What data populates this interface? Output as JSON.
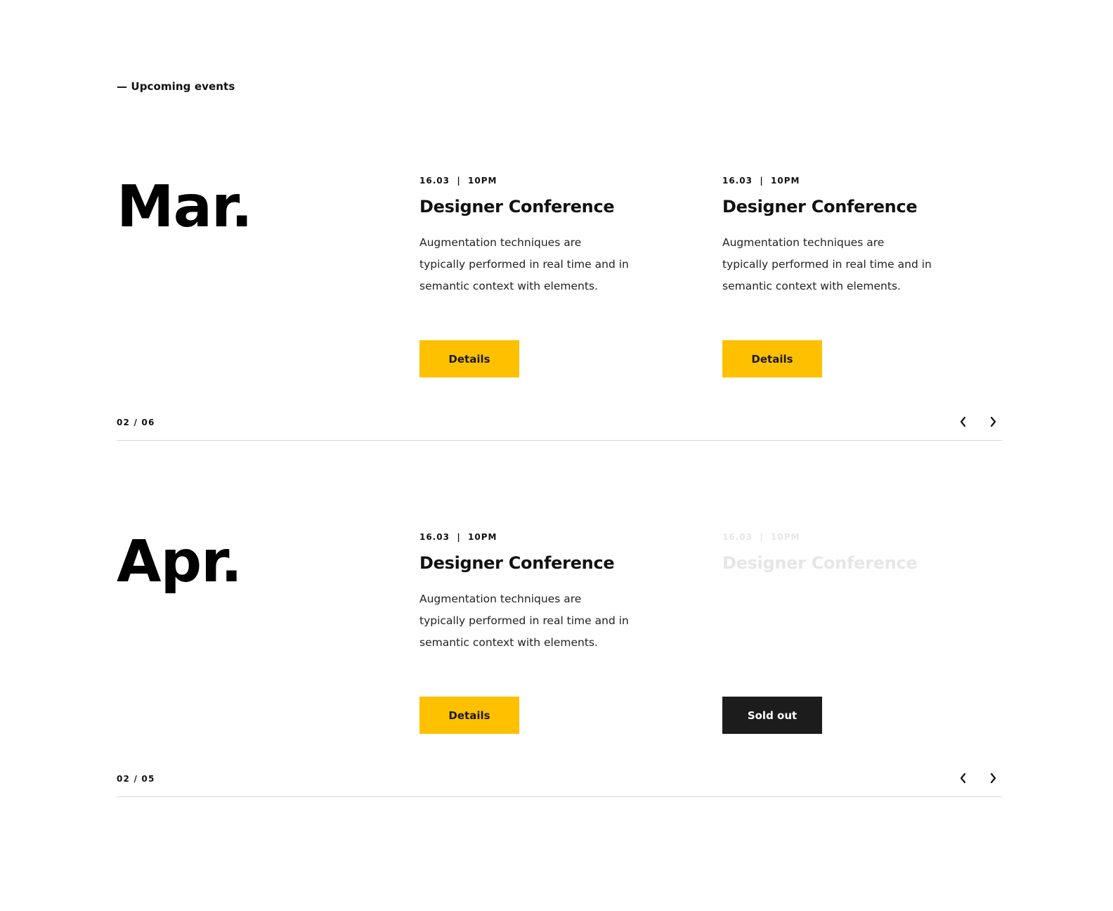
{
  "section": {
    "label": "— Upcoming events"
  },
  "months": [
    {
      "name": "Mar.",
      "pager": "02 / 06",
      "events": [
        {
          "meta": "16.03  |  10PM",
          "title": "Designer Conference",
          "description": "Augmentation techniques are typically performed in real time and in semantic context with elements.",
          "button": "Details"
        },
        {
          "meta": "16.03  |  10PM",
          "title": "Designer Conference",
          "description": "Augmentation techniques are typically performed in real time and in semantic context with elements.",
          "button": "Details"
        }
      ]
    },
    {
      "name": "Apr.",
      "pager": "02 / 05",
      "events": [
        {
          "meta": "16.03  |  10PM",
          "title": "Designer Conference",
          "description": "Augmentation techniques are typically performed in real time and in semantic context with elements.",
          "button": "Details"
        },
        {
          "meta": "16.03  |  10PM",
          "title": "Designer Conference",
          "button": "Sold out",
          "status": "sold-out"
        }
      ]
    }
  ],
  "icons": {
    "prev": "chevron-left-icon",
    "next": "chevron-right-icon"
  },
  "colors": {
    "accent": "#ffc000",
    "dark": "#1c1c1c",
    "faded_text": "#e6e6e6",
    "divider": "#d6d6d6"
  }
}
